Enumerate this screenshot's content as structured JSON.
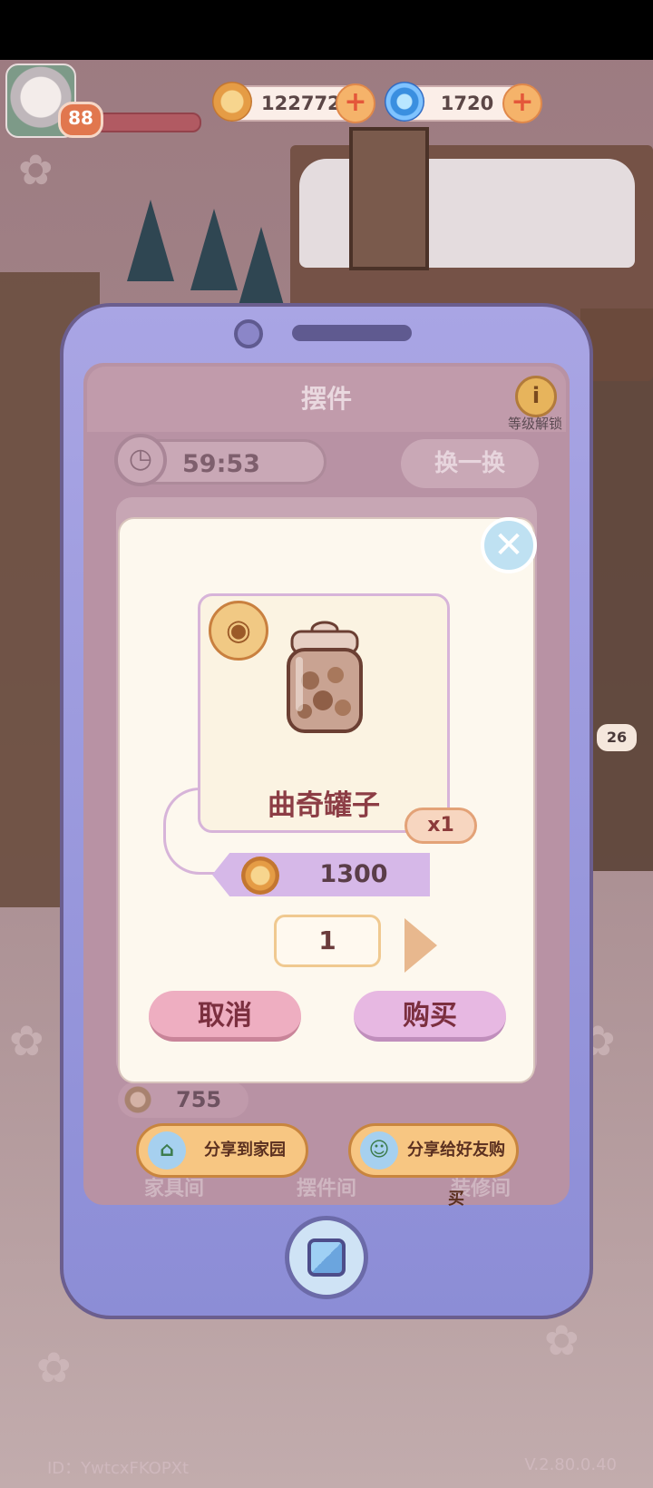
{
  "hud": {
    "level": "88",
    "coins": "122772",
    "gems": "1720"
  },
  "phone": {
    "title": "摆件",
    "info_label": "等级解锁",
    "timer": "59:53",
    "refresh_label": "换一换",
    "under_price": "755",
    "tabs": [
      "家具间",
      "摆件间",
      "装修间"
    ]
  },
  "dialog": {
    "item_name": "曲奇罐子",
    "quantity_badge": "x1",
    "price": "1300",
    "quantity": "1",
    "cancel_label": "取消",
    "buy_label": "购买"
  },
  "share": {
    "home_label": "分享到家园",
    "friend_label": "分享给好友购买"
  },
  "scene": {
    "side_badge": "26"
  },
  "footer": {
    "player_id": "ID：YwtcxFKOPXt",
    "version": "V.2.80.0.40"
  },
  "icons": [
    "coin-icon",
    "swirl-gem-icon",
    "plus-icon",
    "info-icon",
    "clock-icon",
    "eye-icon",
    "close-icon",
    "share-icon",
    "home-square-icon",
    "arrow-right-icon",
    "cookie-jar-icon"
  ],
  "colors": {
    "dialog_bg": "#fdf8ee",
    "phone_body": "#a9a5e4",
    "cancel_bg": "#eeaec1",
    "buy_bg": "#e7b8e2",
    "share_bg": "#f7c682"
  }
}
